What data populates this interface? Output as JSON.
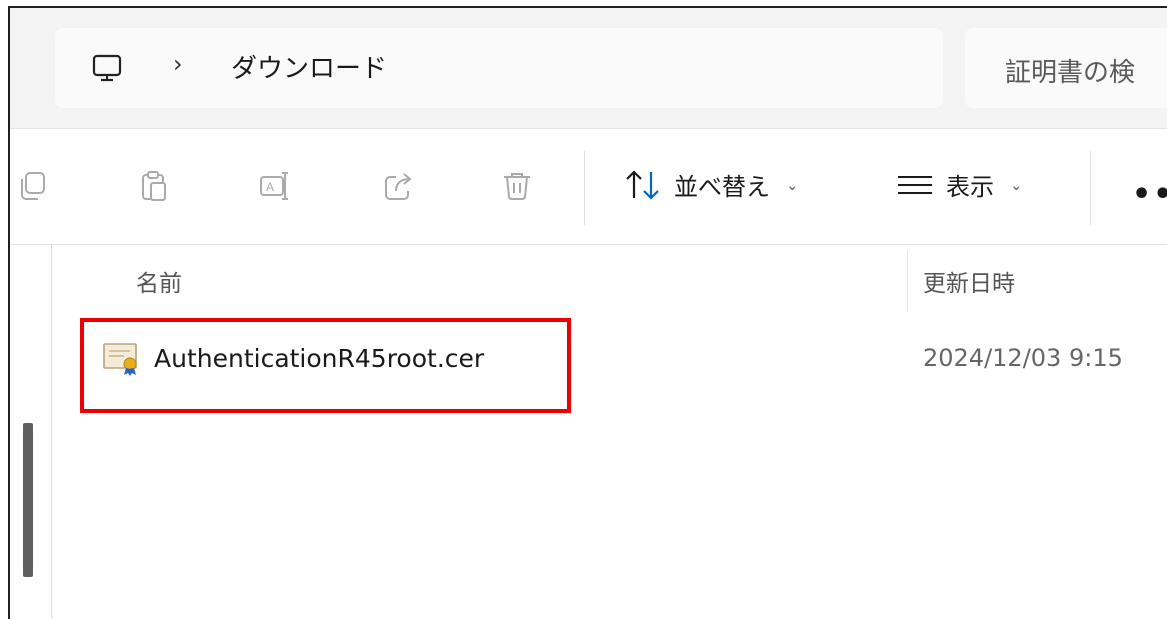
{
  "address_bar": {
    "pc_icon": "computer-icon",
    "separator": "›",
    "current_folder": "ダウンロード"
  },
  "search": {
    "placeholder": "証明書の検"
  },
  "toolbar": {
    "icons": [
      "copy-icon",
      "paste-icon",
      "rename-icon",
      "share-icon",
      "delete-icon"
    ],
    "sort_label": "並べ替え",
    "view_label": "表示",
    "more_label": "•••"
  },
  "columns": {
    "name": "名前",
    "modified": "更新日時"
  },
  "files": [
    {
      "name": "AuthenticationR45root.cer",
      "modified": "2024/12/03 9:15",
      "icon": "certificate-icon"
    }
  ],
  "colors": {
    "highlight": "#ee0000",
    "sort_up": "#1a1a1a",
    "sort_down": "#0067c0"
  }
}
